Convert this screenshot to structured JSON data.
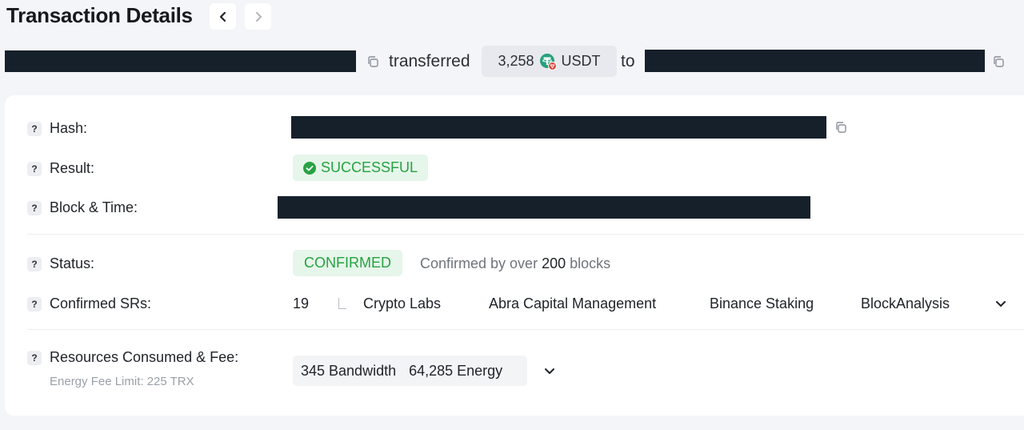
{
  "header": {
    "title": "Transaction Details"
  },
  "summary": {
    "verb": "transferred",
    "amount": "3,258",
    "token": "USDT",
    "preposition": "to"
  },
  "details": {
    "hash_label": "Hash:",
    "result_label": "Result:",
    "result_value": "SUCCESSFUL",
    "block_time_label": "Block & Time:",
    "status_label": "Status:",
    "status_value": "CONFIRMED",
    "status_note_prefix": "Confirmed by over",
    "status_note_count": "200",
    "status_note_suffix": "blocks",
    "srs_label": "Confirmed SRs:",
    "srs_count": "19",
    "srs": [
      "Crypto Labs",
      "Abra Capital Management",
      "Binance Staking",
      "BlockAnalysis"
    ],
    "resources_label": "Resources Consumed & Fee:",
    "energy_fee_limit": "Energy Fee Limit: 225 TRX",
    "bandwidth": "345 Bandwidth",
    "energy": "64,285 Energy"
  },
  "icons": {
    "help": "?",
    "copy": "copy-icon",
    "check": "check-circle-icon",
    "chevron_left": "chevron-left-icon",
    "chevron_right": "chevron-right-icon",
    "chevron_down": "chevron-down-icon",
    "token": "usdt-token-icon"
  },
  "colors": {
    "success_green": "#27a243",
    "success_bg": "#e6f6ea",
    "redaction": "#16202b",
    "usdt_green": "#26a17b",
    "tron_red": "#e0493c"
  }
}
